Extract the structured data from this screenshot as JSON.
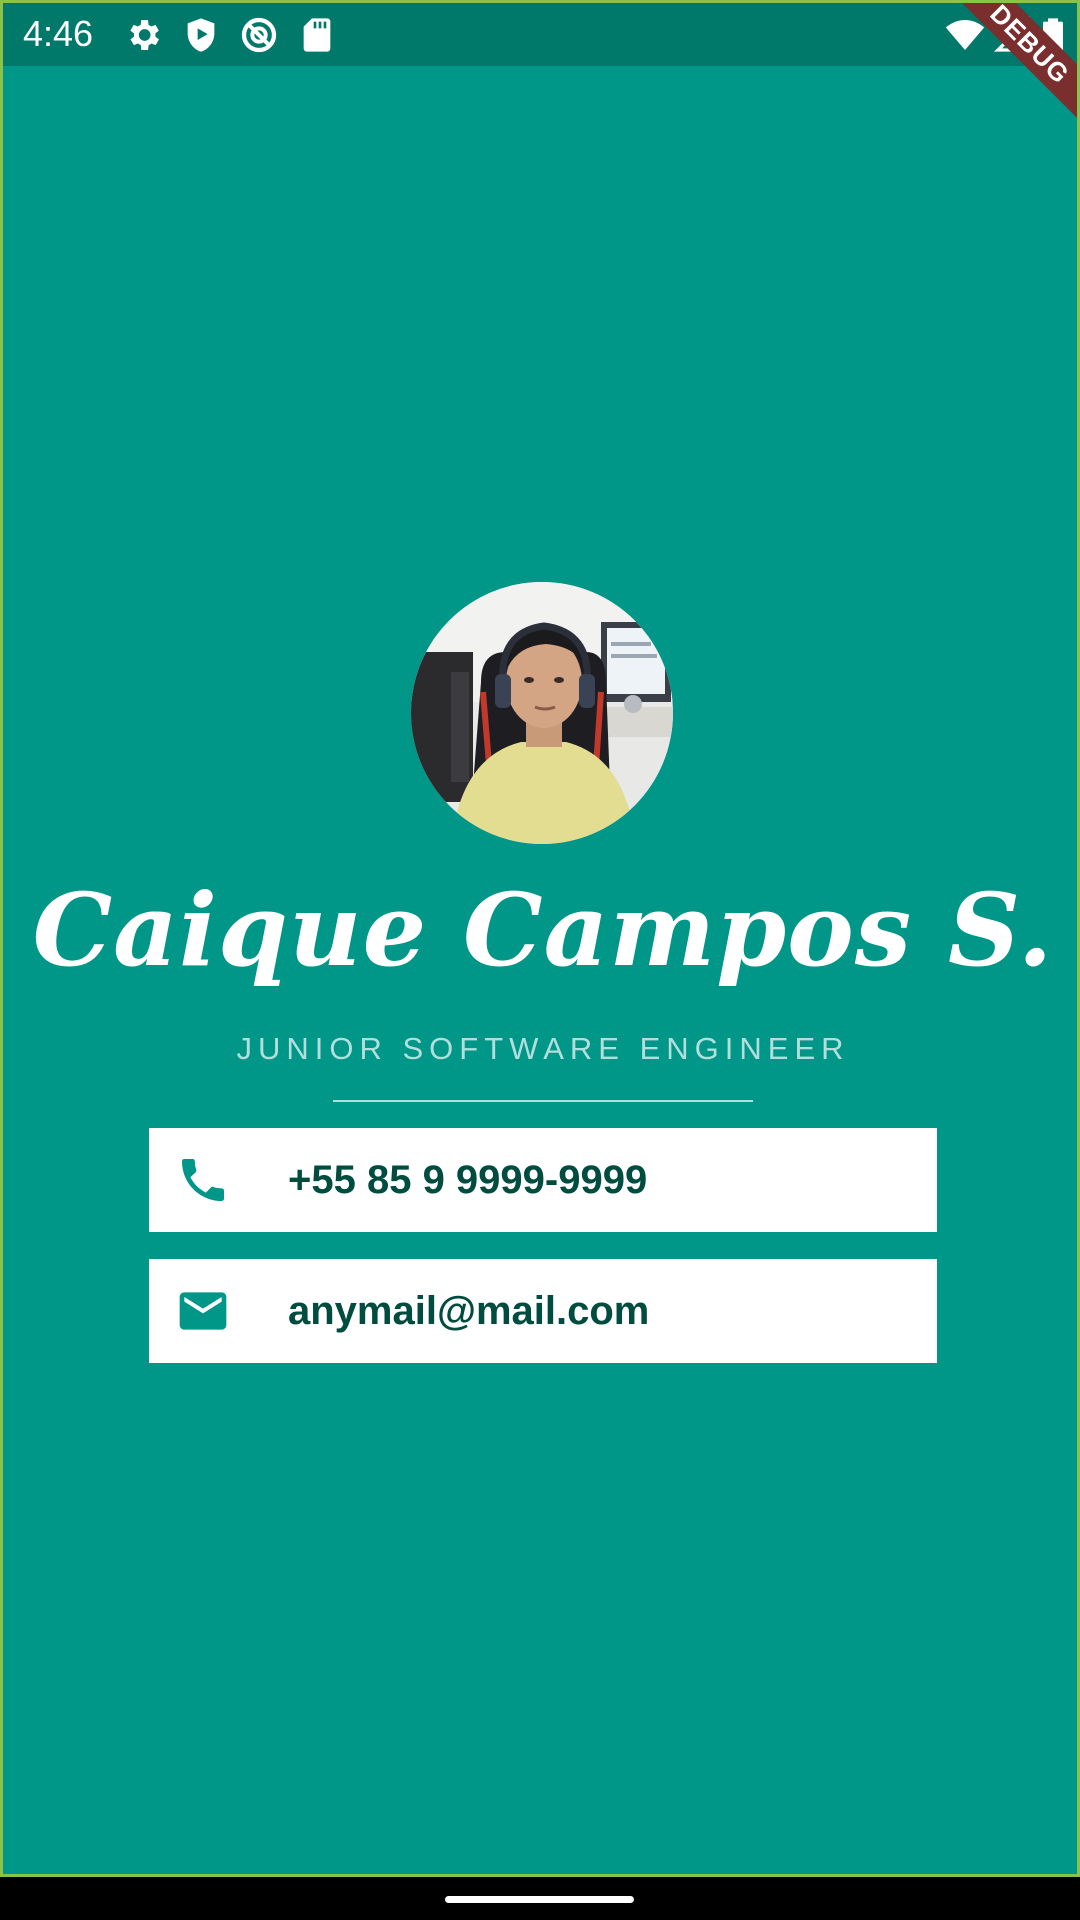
{
  "status_bar": {
    "time": "4:46",
    "left_icons": [
      "gear-icon",
      "play-protect-icon",
      "sync-icon",
      "sd-card-icon"
    ],
    "right_icons": [
      "wifi-icon",
      "cell-signal-icon",
      "battery-icon"
    ]
  },
  "debug_banner": "DEBUG",
  "profile": {
    "name": "Caique Campos S.",
    "role": "JUNIOR SOFTWARE ENGINEER"
  },
  "contacts": [
    {
      "icon": "phone-icon",
      "value": "+55 85 9 9999-9999"
    },
    {
      "icon": "mail-icon",
      "value": "anymail@mail.com"
    }
  ],
  "colors": {
    "background": "#009688",
    "status_bar": "#00796b",
    "card": "#ffffff",
    "card_text": "#004d40",
    "icon": "#009688",
    "role_text": "#b2dfdb",
    "debug_ribbon": "#7a2e2e"
  }
}
